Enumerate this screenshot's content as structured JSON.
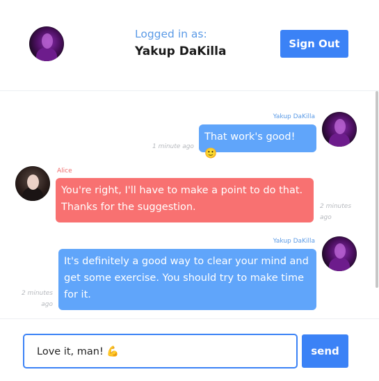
{
  "header": {
    "logged_in_label": "Logged in as:",
    "user_name": "Yakup DaKilla",
    "signout_label": "Sign Out"
  },
  "messages": [
    {
      "author": "Yakup DaKilla",
      "text": "That work's good! 🙂",
      "time_line1": "1 minute ago",
      "time_line2": "",
      "side": "right"
    },
    {
      "author": "Alice",
      "text": "You're right, I'll have to make a point to do that. Thanks for the suggestion.",
      "time_line1": "2 minutes",
      "time_line2": "ago",
      "side": "left"
    },
    {
      "author": "Yakup DaKilla",
      "text": "It's definitely a good way to clear your mind and get some exercise. You should try to make time for it.",
      "time_line1": "2 minutes",
      "time_line2": "ago",
      "side": "right"
    }
  ],
  "composer": {
    "input_value": "Love it, man! 💪",
    "send_label": "send"
  },
  "colors": {
    "primary": "#3b82f6",
    "own_bubble": "#60a5fa",
    "other_bubble": "#f87171"
  }
}
